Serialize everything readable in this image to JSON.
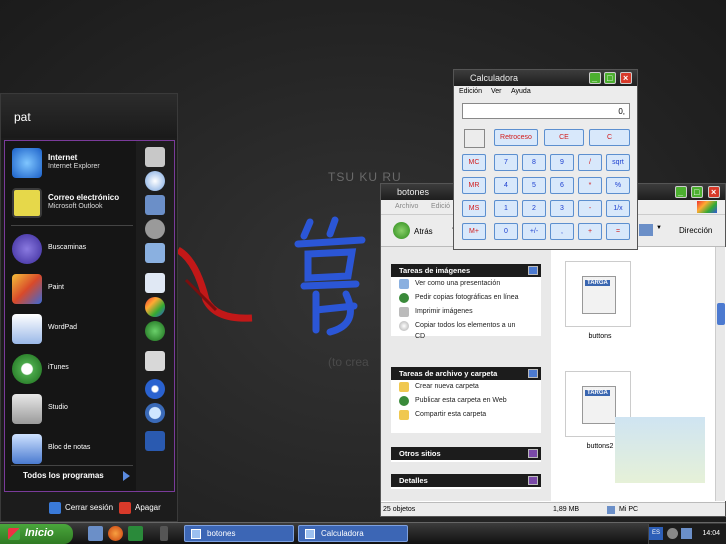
{
  "wallpaper": {
    "caption": "TSU KU RU",
    "subcaption": "(to crea"
  },
  "start_menu": {
    "user": "pat",
    "pinned": [
      {
        "title": "Internet",
        "subtitle": "Internet Explorer"
      },
      {
        "title": "Correo electrónico",
        "subtitle": "Microsoft Outlook"
      }
    ],
    "recent": [
      "Buscaminas",
      "Paint",
      "WordPad",
      "iTunes",
      "Studio",
      "Bloc de notas"
    ],
    "all_programs": "Todos los programas",
    "logoff": "Cerrar sesión",
    "shutdown": "Apagar"
  },
  "explorer": {
    "title": "botones",
    "menu": [
      "Archivo",
      "Edició"
    ],
    "back_label": "Atrás",
    "address_label": "Dirección",
    "image_tasks": {
      "header": "Tareas de imágenes",
      "items": [
        "Ver como una presentación",
        "Pedir copias fotográficas en línea",
        "Imprimir imágenes",
        "Copiar todos los elementos a un",
        "CD"
      ]
    },
    "file_tasks": {
      "header": "Tareas de archivo y carpeta",
      "items": [
        "Crear nueva carpeta",
        "Publicar esta carpeta en Web",
        "Compartir esta carpeta"
      ]
    },
    "other_places": "Otros sitios",
    "details": "Detalles",
    "files": [
      {
        "name": "buttons",
        "badge": "TARGA"
      },
      {
        "name": "buttons2",
        "badge": "TARGA"
      }
    ],
    "status": {
      "count": "25 objetos",
      "size": "1,89 MB",
      "location": "Mi PC"
    }
  },
  "calculator": {
    "title": "Calculadora",
    "menu": [
      "Edición",
      "Ver",
      "Ayuda"
    ],
    "display": "0,",
    "top_row": [
      "Retroceso",
      "CE",
      "C"
    ],
    "memory": [
      "MC",
      "MR",
      "MS",
      "M+"
    ],
    "rows": [
      [
        "7",
        "8",
        "9",
        "/",
        "sqrt"
      ],
      [
        "4",
        "5",
        "6",
        "*",
        "%"
      ],
      [
        "1",
        "2",
        "3",
        "-",
        "1/x"
      ],
      [
        "0",
        "+/-",
        ",",
        "+",
        "="
      ]
    ]
  },
  "taskbar": {
    "start": "Inicio",
    "tasks": [
      "botones",
      "Calculadora"
    ],
    "lang": "ES",
    "clock": "14:04"
  }
}
